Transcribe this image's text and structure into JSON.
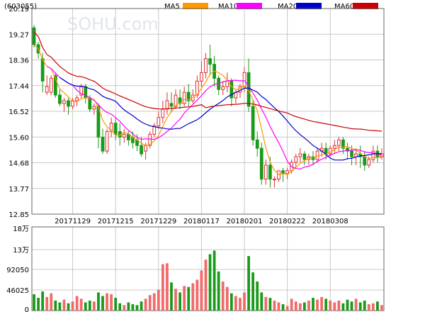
{
  "header": {
    "code": "(603055)",
    "legend": [
      {
        "label": "MA5",
        "color": "#ff9900"
      },
      {
        "label": "MA10",
        "color": "#ff00ff"
      },
      {
        "label": "MA20",
        "color": "#0000cc"
      },
      {
        "label": "MA60",
        "color": "#cc0000"
      }
    ]
  },
  "watermark": "SOHU.com",
  "colors": {
    "up": "#e03030",
    "down": "#1a9a1a",
    "grid": "#c8c8c8",
    "frame": "#666666",
    "text": "#000000"
  },
  "chart_data": {
    "type": "candlestick",
    "price_axis": {
      "ticks": [
        "20.19",
        "19.27",
        "18.36",
        "17.44",
        "16.52",
        "15.60",
        "14.68",
        "13.77",
        "12.85"
      ],
      "range": [
        12.85,
        20.19
      ]
    },
    "date_ticks": [
      "20171129",
      "20171215",
      "20171229",
      "20180117",
      "20180201",
      "20180222",
      "20180308"
    ],
    "date_tick_index": [
      9,
      19,
      29,
      39,
      49,
      59,
      69
    ],
    "volume_axis": {
      "ticks": [
        "18万",
        "13万",
        "92050",
        "46025",
        "0"
      ],
      "range": [
        0,
        184100
      ]
    },
    "candles": [
      [
        19.5,
        19.6,
        18.9,
        18.8
      ],
      [
        18.9,
        19.0,
        18.6,
        18.4
      ],
      [
        18.4,
        18.6,
        17.6,
        17.2
      ],
      [
        17.2,
        17.8,
        17.4,
        17.1
      ],
      [
        17.2,
        17.8,
        17.7,
        17.1
      ],
      [
        17.8,
        17.9,
        17.1,
        17.0
      ],
      [
        17.1,
        17.3,
        16.8,
        16.7
      ],
      [
        16.8,
        17.0,
        16.9,
        16.5
      ],
      [
        16.9,
        17.0,
        16.7,
        16.4
      ],
      [
        16.7,
        17.0,
        16.9,
        16.6
      ],
      [
        16.9,
        17.1,
        17.0,
        16.7
      ],
      [
        17.1,
        17.5,
        17.4,
        17.0
      ],
      [
        17.4,
        17.5,
        17.0,
        16.8
      ],
      [
        17.0,
        17.1,
        16.6,
        16.5
      ],
      [
        16.6,
        16.8,
        16.7,
        16.4
      ],
      [
        16.7,
        16.8,
        15.6,
        15.2
      ],
      [
        15.6,
        15.9,
        15.1,
        15.0
      ],
      [
        15.1,
        15.9,
        15.8,
        15.0
      ],
      [
        15.8,
        16.3,
        16.1,
        15.6
      ],
      [
        16.1,
        16.3,
        15.7,
        15.5
      ],
      [
        15.8,
        16.1,
        15.6,
        15.3
      ],
      [
        15.6,
        15.9,
        15.7,
        15.4
      ],
      [
        15.7,
        15.8,
        15.5,
        15.3
      ],
      [
        15.6,
        15.8,
        15.4,
        15.2
      ],
      [
        15.5,
        15.7,
        15.3,
        15.1
      ],
      [
        15.3,
        15.6,
        15.0,
        14.9
      ],
      [
        15.1,
        15.4,
        15.3,
        14.8
      ],
      [
        15.3,
        15.8,
        15.7,
        15.2
      ],
      [
        15.7,
        16.1,
        16.0,
        15.6
      ],
      [
        16.0,
        16.5,
        16.3,
        15.9
      ],
      [
        16.3,
        16.9,
        16.6,
        16.1
      ],
      [
        16.6,
        17.2,
        16.9,
        16.4
      ],
      [
        16.8,
        17.2,
        16.7,
        16.5
      ],
      [
        16.7,
        17.3,
        17.1,
        16.6
      ],
      [
        17.0,
        17.3,
        16.8,
        16.6
      ],
      [
        16.8,
        17.4,
        17.2,
        16.7
      ],
      [
        17.2,
        17.5,
        16.9,
        16.7
      ],
      [
        16.9,
        17.3,
        17.1,
        16.8
      ],
      [
        17.1,
        17.8,
        17.6,
        17.0
      ],
      [
        17.6,
        18.3,
        17.9,
        17.4
      ],
      [
        17.9,
        18.6,
        18.4,
        17.7
      ],
      [
        18.4,
        18.9,
        18.2,
        17.8
      ],
      [
        18.2,
        18.5,
        17.7,
        17.4
      ],
      [
        17.7,
        17.8,
        17.3,
        17.1
      ],
      [
        17.3,
        17.6,
        17.4,
        17.1
      ],
      [
        17.4,
        17.9,
        17.6,
        17.2
      ],
      [
        17.6,
        17.7,
        17.0,
        16.7
      ],
      [
        17.0,
        17.3,
        17.2,
        16.8
      ],
      [
        17.2,
        17.5,
        17.4,
        17.0
      ],
      [
        17.4,
        18.1,
        17.9,
        17.2
      ],
      [
        17.9,
        18.4,
        16.7,
        16.5
      ],
      [
        16.7,
        16.9,
        15.5,
        15.3
      ],
      [
        15.5,
        15.8,
        15.2,
        14.9
      ],
      [
        15.2,
        15.4,
        14.1,
        13.9
      ],
      [
        14.1,
        14.8,
        14.6,
        13.9
      ],
      [
        14.6,
        14.9,
        14.1,
        13.8
      ],
      [
        14.1,
        14.2,
        14.1,
        13.8
      ],
      [
        14.1,
        14.4,
        14.4,
        14.0
      ],
      [
        14.4,
        14.5,
        14.3,
        14.0
      ],
      [
        14.3,
        14.5,
        14.4,
        14.1
      ],
      [
        14.4,
        14.8,
        14.7,
        14.3
      ],
      [
        14.7,
        15.0,
        14.9,
        14.5
      ],
      [
        14.9,
        15.2,
        15.0,
        14.7
      ],
      [
        15.0,
        15.1,
        14.8,
        14.6
      ],
      [
        14.8,
        15.0,
        14.9,
        14.6
      ],
      [
        14.9,
        15.1,
        14.8,
        14.6
      ],
      [
        14.8,
        15.2,
        15.1,
        14.7
      ],
      [
        15.1,
        15.4,
        15.2,
        14.9
      ],
      [
        15.2,
        15.4,
        15.0,
        14.8
      ],
      [
        15.0,
        15.3,
        15.2,
        14.9
      ],
      [
        15.2,
        15.5,
        15.3,
        15.0
      ],
      [
        15.3,
        15.6,
        15.5,
        15.1
      ],
      [
        15.5,
        15.6,
        15.2,
        15.0
      ],
      [
        15.2,
        15.4,
        15.1,
        14.8
      ],
      [
        15.1,
        15.3,
        14.9,
        14.6
      ],
      [
        14.9,
        15.2,
        15.0,
        14.6
      ],
      [
        15.0,
        15.3,
        14.9,
        14.5
      ],
      [
        14.9,
        15.1,
        14.6,
        14.4
      ],
      [
        14.6,
        14.9,
        14.8,
        14.5
      ],
      [
        14.8,
        15.3,
        15.1,
        14.7
      ],
      [
        15.1,
        15.3,
        14.9,
        14.7
      ],
      [
        14.9,
        15.2,
        15.0,
        14.8
      ]
    ],
    "volume": [
      36000,
      28000,
      42000,
      30000,
      38000,
      22000,
      18000,
      24000,
      16000,
      20000,
      32000,
      26000,
      18000,
      22000,
      20000,
      40000,
      32000,
      38000,
      36000,
      28000,
      16000,
      12000,
      18000,
      14000,
      12000,
      20000,
      26000,
      34000,
      38000,
      46000,
      102000,
      104000,
      62000,
      48000,
      40000,
      54000,
      52000,
      60000,
      68000,
      88000,
      112000,
      124000,
      132000,
      86000,
      64000,
      52000,
      38000,
      32000,
      28000,
      40000,
      120000,
      84000,
      64000,
      40000,
      30000,
      28000,
      22000,
      18000,
      14000,
      10000,
      26000,
      20000,
      16000,
      18000,
      22000,
      28000,
      24000,
      30000,
      26000,
      22000,
      18000,
      22000,
      16000,
      24000,
      20000,
      26000,
      18000,
      22000,
      14000,
      16000,
      20000,
      12000
    ],
    "ma": {
      "MA5": [],
      "MA10": [],
      "MA20": [],
      "MA60": []
    }
  }
}
